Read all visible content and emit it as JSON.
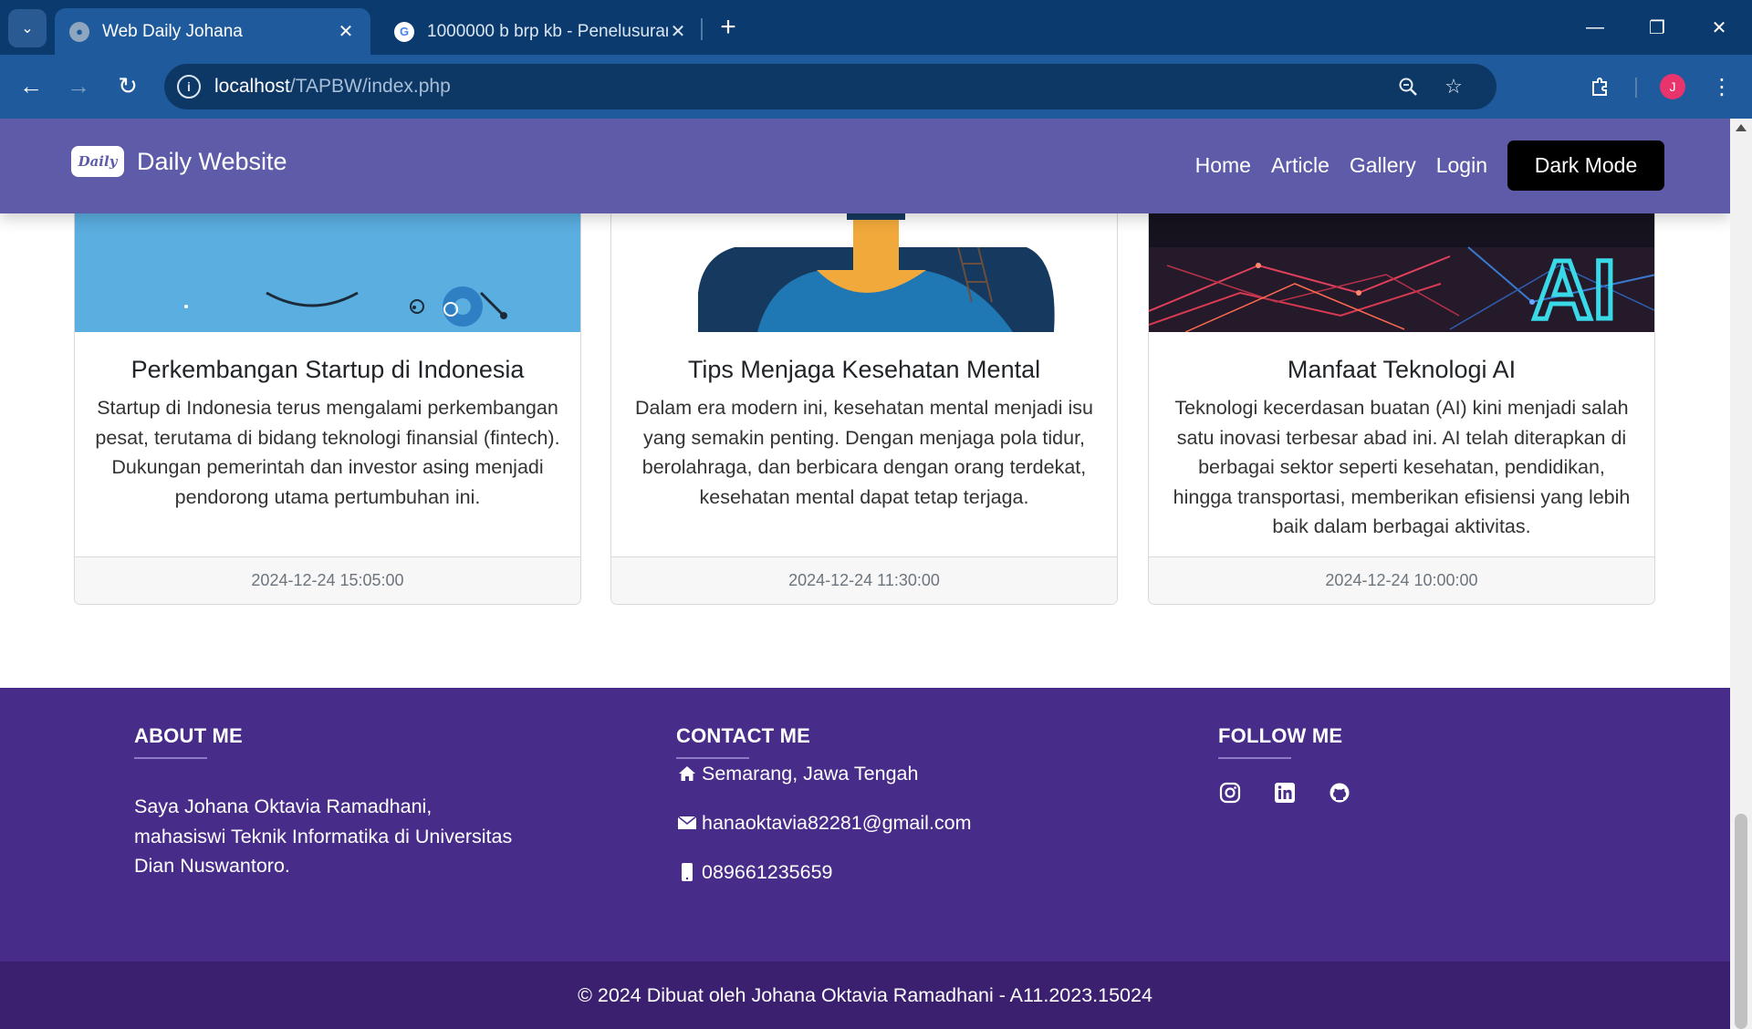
{
  "browser": {
    "tabs": [
      {
        "title": "Web Daily Johana",
        "active": true
      },
      {
        "title": "1000000 b brp kb - Penelusuran",
        "active": false
      }
    ],
    "url_host": "localhost",
    "url_path": "/TAPBW/index.php",
    "profile_initial": "J"
  },
  "site": {
    "brand_logo_text": "Daily",
    "brand_name": "Daily Website",
    "nav": {
      "home": "Home",
      "article": "Article",
      "gallery": "Gallery",
      "login": "Login",
      "dark_mode": "Dark Mode"
    }
  },
  "articles": [
    {
      "title": "Perkembangan Startup di Indonesia",
      "text": "Startup di Indonesia terus mengalami perkembangan pesat, terutama di bidang teknologi finansial (fintech). Dukungan pemerintah dan investor asing menjadi pendorong utama pertumbuhan ini.",
      "date": "2024-12-24 15:05:00"
    },
    {
      "title": "Tips Menjaga Kesehatan Mental",
      "text": "Dalam era modern ini, kesehatan mental menjadi isu yang semakin penting. Dengan menjaga pola tidur, berolahraga, dan berbicara dengan orang terdekat, kesehatan mental dapat tetap terjaga.",
      "date": "2024-12-24 11:30:00"
    },
    {
      "title": "Manfaat Teknologi AI",
      "text": "Teknologi kecerdasan buatan (AI) kini menjadi salah satu inovasi terbesar abad ini. AI telah diterapkan di berbagai sektor seperti kesehatan, pendidikan, hingga transportasi, memberikan efisiensi yang lebih baik dalam berbagai aktivitas.",
      "date": "2024-12-24 10:00:00",
      "image_text": "AI"
    }
  ],
  "footer": {
    "about": {
      "heading": "ABOUT ME",
      "text": "Saya Johana Oktavia Ramadhani, mahasiswi Teknik Informatika di Universitas Dian Nuswantoro."
    },
    "contact": {
      "heading": "CONTACT ME",
      "address": "Semarang, Jawa Tengah",
      "email": "hanaoktavia82281@gmail.com",
      "phone": "089661235659"
    },
    "follow": {
      "heading": "FOLLOW ME",
      "icons": [
        "instagram-icon",
        "linkedin-icon",
        "github-icon"
      ]
    },
    "copyright": "© 2024 Dibuat oleh Johana Oktavia Ramadhani - A11.2023.15024"
  },
  "colors": {
    "navbar": "#5e5ca8",
    "footer": "#482c8a",
    "copyright_bar": "#3a206f",
    "browser_frame": "#1f5a9c"
  }
}
